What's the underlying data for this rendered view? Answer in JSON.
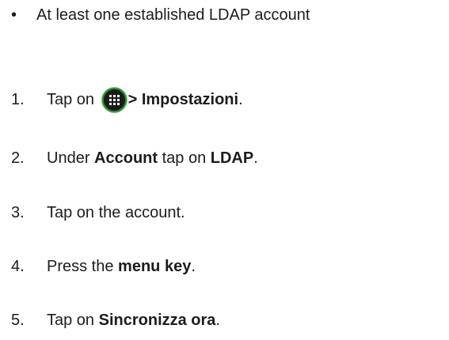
{
  "prereq": {
    "bullet": "•",
    "text": "At least one established LDAP account"
  },
  "steps": [
    {
      "num": "1.",
      "pre": "Tap on ",
      "icon": "app-drawer-icon",
      "bold": "> Impostazioni",
      "post": "."
    },
    {
      "num": "2.",
      "pre": "Under ",
      "bold": "Account",
      "mid": " tap on ",
      "bold2": "LDAP",
      "post": "."
    },
    {
      "num": "3.",
      "pre": "Tap on the account."
    },
    {
      "num": "4.",
      "pre": "Press the ",
      "bold": "menu key",
      "post": "."
    },
    {
      "num": "5.",
      "pre": "Tap on ",
      "bold": "Sincronizza ora",
      "post": "."
    }
  ]
}
